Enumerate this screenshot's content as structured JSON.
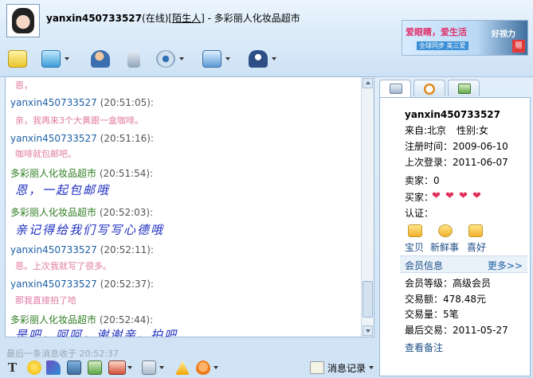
{
  "header": {
    "username": "yanxin450733527",
    "status": "(在线)",
    "stranger_tag": "陌生人",
    "store_title": "- 多彩丽人化妆品超市",
    "ad": {
      "line1": "爱眼睛，爱生活",
      "line2": "全球同步 美三爱",
      "line3": "好视力",
      "badge": "赠"
    }
  },
  "toolbar": {
    "icons": [
      "notes-icon",
      "file-transfer-icon",
      "add-contact-icon",
      "voice-icon",
      "webcam-icon",
      "remote-assist-icon",
      "security-icon"
    ]
  },
  "messages": [
    {
      "sender": "",
      "time": "",
      "text": "恩，",
      "style": "pink"
    },
    {
      "sender": "yanxin450733527",
      "time": "(20:51:05):",
      "text": "亲，我再来3个大黄跟一盒咖啡。",
      "style": "pink",
      "sender_color": "blue"
    },
    {
      "sender": "yanxin450733527",
      "time": "(20:51:16):",
      "text": "咖啡就包邮吧。",
      "style": "pink",
      "sender_color": "blue"
    },
    {
      "sender": "多彩丽人化妆品超市",
      "time": "(20:51:54):",
      "text": "恩，一起包邮哦",
      "style": "blue",
      "sender_color": "green"
    },
    {
      "sender": "多彩丽人化妆品超市",
      "time": "(20:52:03):",
      "text": "亲记得给我们写写心德哦",
      "style": "blue",
      "sender_color": "green"
    },
    {
      "sender": "yanxin450733527",
      "time": "(20:52:11):",
      "text": "恩。上次我就写了很多。",
      "style": "pink",
      "sender_color": "blue"
    },
    {
      "sender": "yanxin450733527",
      "time": "(20:52:37):",
      "text": "那我直接拍了哈",
      "style": "pink",
      "sender_color": "blue"
    },
    {
      "sender": "多彩丽人化妆品超市",
      "time": "(20:52:44):",
      "text": "是吧，呵呵，谢谢亲，拍吧",
      "style": "blue",
      "sender_color": "green"
    }
  ],
  "last_message": "最后一条消息收于 20:52:37",
  "input_toolbar": {
    "icons": [
      "font-icon",
      "emoticon-icon",
      "magic-icon",
      "screenshot-icon",
      "send-file-icon",
      "image-icon",
      "shake-icon",
      "flower-icon"
    ],
    "history_label": "消息记录"
  },
  "profile": {
    "name": "yanxin450733527",
    "from": "来自:北京",
    "gender": "性别:女",
    "reg_time": "注册时间：2009-06-10",
    "last_login": "上次登录：2011-06-07",
    "seller": "卖家：0",
    "buyer": "买家：",
    "verify": "认证：",
    "shortcuts": [
      "宝贝",
      "新鲜事",
      "喜好"
    ],
    "vip_title": "会员信息",
    "more": "更多>>",
    "vip_level": "会员等级：高级会员",
    "trade_amount": "交易额：478.48元",
    "trade_count": "交易量：5笔",
    "last_trade": "最后交易：2011-05-27",
    "view_notes": "查看备注"
  },
  "colors": {
    "pink_text": "#e07aa2",
    "blue_text": "#1f2fc0",
    "sender_blue": "#1d5fa6",
    "sender_green": "#2e7d21"
  }
}
